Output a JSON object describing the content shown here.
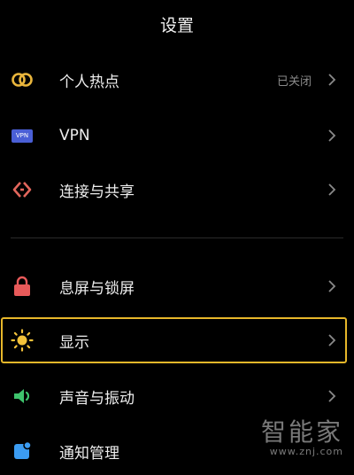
{
  "header": {
    "title": "设置"
  },
  "items": [
    {
      "label": "个人热点",
      "value": "已关闭",
      "icon": "hotspot-icon"
    },
    {
      "label": "VPN",
      "icon": "vpn-icon",
      "icon_text": "VPN"
    },
    {
      "label": "连接与共享",
      "icon": "share-icon"
    },
    {
      "label": "息屏与锁屏",
      "icon": "lock-icon"
    },
    {
      "label": "显示",
      "icon": "sun-icon"
    },
    {
      "label": "声音与振动",
      "icon": "speaker-icon"
    },
    {
      "label": "通知管理",
      "icon": "notification-icon"
    }
  ],
  "watermark": {
    "main": "智能家",
    "url": "www.znj.com"
  },
  "colors": {
    "background": "#000000",
    "highlight": "#e7b72a",
    "hotspot": "#e9b53c",
    "vpn": "#4a5fd6",
    "share": "#e2665c",
    "lock": "#e85a5a",
    "sun": "#f3c23a",
    "speaker": "#3ec46d",
    "notification": "#3b9cf2"
  }
}
